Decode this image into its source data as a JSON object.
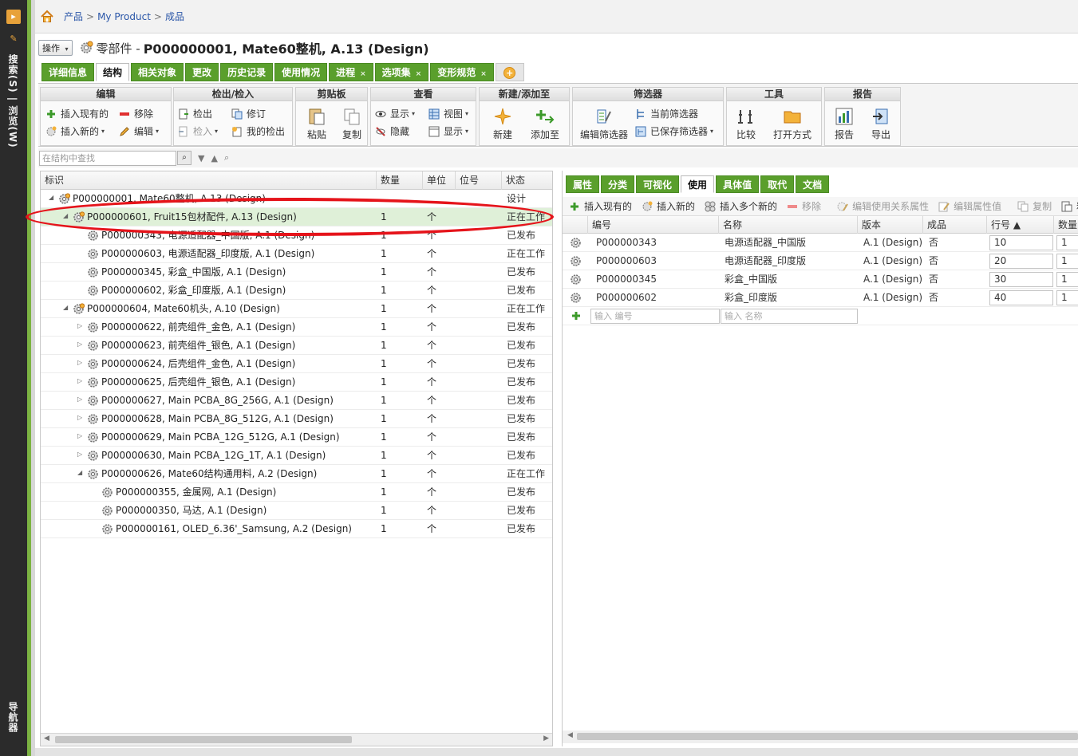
{
  "sidebar": {
    "search_browse": "搜索(S) | 浏览(W)",
    "bottom_label": "导航器"
  },
  "breadcrumb": {
    "items": [
      "产品",
      "My Product",
      "成品"
    ],
    "separator": ">"
  },
  "title": {
    "ops_label": "操作",
    "prefix": "零部件 -",
    "main": "P000000001, Mate60整机, A.13 (Design)"
  },
  "main_tabs": [
    {
      "label": "详细信息",
      "active": false,
      "closable": false
    },
    {
      "label": "结构",
      "active": true,
      "closable": false
    },
    {
      "label": "相关对象",
      "active": false,
      "closable": false
    },
    {
      "label": "更改",
      "active": false,
      "closable": false
    },
    {
      "label": "历史记录",
      "active": false,
      "closable": false
    },
    {
      "label": "使用情况",
      "active": false,
      "closable": false
    },
    {
      "label": "进程",
      "active": false,
      "closable": true
    },
    {
      "label": "选项集",
      "active": false,
      "closable": true
    },
    {
      "label": "变形规范",
      "active": false,
      "closable": true
    }
  ],
  "ribbon": {
    "edit": {
      "title": "编辑",
      "insert_existing": "插入现有的",
      "remove": "移除",
      "insert_new": "插入新的",
      "edit": "编辑"
    },
    "checkout": {
      "title": "检出/检入",
      "checkout": "检出",
      "revise": "修订",
      "checkin": "检入",
      "my_checkouts": "我的检出"
    },
    "clipboard": {
      "title": "剪贴板",
      "paste": "粘贴",
      "copy": "复制"
    },
    "view": {
      "title": "查看",
      "show": "显示",
      "view": "视图",
      "hide": "隐藏",
      "display": "显示"
    },
    "create": {
      "title": "新建/添加至",
      "new": "新建",
      "add_to": "添加至"
    },
    "filter": {
      "title": "筛选器",
      "edit_filter": "编辑筛选器",
      "current_filter": "当前筛选器",
      "saved_filter": "已保存筛选器"
    },
    "tools": {
      "title": "工具",
      "compare": "比较",
      "open_with": "打开方式"
    },
    "report": {
      "title": "报告",
      "report": "报告",
      "export": "导出"
    }
  },
  "search": {
    "placeholder": "在结构中查找"
  },
  "tree": {
    "columns": [
      "标识",
      "数量",
      "单位",
      "位号",
      "状态"
    ],
    "rows": [
      {
        "label": "P000000001, Mate60整机, A.13 (Design)",
        "qty": "",
        "unit": "",
        "state": "设计",
        "level": 0,
        "toggle": "open"
      },
      {
        "label": "P000000601, Fruit15包材配件, A.13 (Design)",
        "qty": "1",
        "unit": "个",
        "state": "正在工作",
        "level": 1,
        "toggle": "open",
        "selected": true
      },
      {
        "label": "P000000343, 电源适配器_中国版, A.1 (Design)",
        "qty": "1",
        "unit": "个",
        "state": "已发布",
        "level": 2,
        "toggle": "none"
      },
      {
        "label": "P000000603, 电源适配器_印度版, A.1 (Design)",
        "qty": "1",
        "unit": "个",
        "state": "正在工作",
        "level": 2,
        "toggle": "none"
      },
      {
        "label": "P000000345, 彩盒_中国版, A.1 (Design)",
        "qty": "1",
        "unit": "个",
        "state": "已发布",
        "level": 2,
        "toggle": "none"
      },
      {
        "label": "P000000602, 彩盒_印度版, A.1 (Design)",
        "qty": "1",
        "unit": "个",
        "state": "已发布",
        "level": 2,
        "toggle": "none"
      },
      {
        "label": "P000000604, Mate60机头, A.10 (Design)",
        "qty": "1",
        "unit": "个",
        "state": "正在工作",
        "level": 1,
        "toggle": "open"
      },
      {
        "label": "P000000622, 前壳组件_金色, A.1 (Design)",
        "qty": "1",
        "unit": "个",
        "state": "已发布",
        "level": 2,
        "toggle": "closed"
      },
      {
        "label": "P000000623, 前壳组件_银色, A.1 (Design)",
        "qty": "1",
        "unit": "个",
        "state": "已发布",
        "level": 2,
        "toggle": "closed"
      },
      {
        "label": "P000000624, 后壳组件_金色, A.1 (Design)",
        "qty": "1",
        "unit": "个",
        "state": "已发布",
        "level": 2,
        "toggle": "closed"
      },
      {
        "label": "P000000625, 后壳组件_银色, A.1 (Design)",
        "qty": "1",
        "unit": "个",
        "state": "已发布",
        "level": 2,
        "toggle": "closed"
      },
      {
        "label": "P000000627, Main PCBA_8G_256G, A.1 (Design)",
        "qty": "1",
        "unit": "个",
        "state": "已发布",
        "level": 2,
        "toggle": "closed"
      },
      {
        "label": "P000000628, Main PCBA_8G_512G, A.1 (Design)",
        "qty": "1",
        "unit": "个",
        "state": "已发布",
        "level": 2,
        "toggle": "closed"
      },
      {
        "label": "P000000629, Main PCBA_12G_512G, A.1 (Design)",
        "qty": "1",
        "unit": "个",
        "state": "已发布",
        "level": 2,
        "toggle": "closed"
      },
      {
        "label": "P000000630, Main PCBA_12G_1T, A.1 (Design)",
        "qty": "1",
        "unit": "个",
        "state": "已发布",
        "level": 2,
        "toggle": "closed"
      },
      {
        "label": "P000000626, Mate60结构通用料, A.2 (Design)",
        "qty": "1",
        "unit": "个",
        "state": "正在工作",
        "level": 2,
        "toggle": "open"
      },
      {
        "label": "P000000355, 金属网, A.1 (Design)",
        "qty": "1",
        "unit": "个",
        "state": "已发布",
        "level": 3,
        "toggle": "none"
      },
      {
        "label": "P000000350, 马达, A.1 (Design)",
        "qty": "1",
        "unit": "个",
        "state": "已发布",
        "level": 3,
        "toggle": "none"
      },
      {
        "label": "P000000161, OLED_6.36'_Samsung, A.2 (Design)",
        "qty": "1",
        "unit": "个",
        "state": "已发布",
        "level": 3,
        "toggle": "none"
      }
    ]
  },
  "right": {
    "tabs": [
      {
        "label": "属性",
        "active": false
      },
      {
        "label": "分类",
        "active": false
      },
      {
        "label": "可视化",
        "active": false
      },
      {
        "label": "使用",
        "active": true
      },
      {
        "label": "具体值",
        "active": false
      },
      {
        "label": "取代",
        "active": false
      },
      {
        "label": "文档",
        "active": false
      }
    ],
    "toolbar": {
      "insert_existing": "插入现有的",
      "insert_new": "插入新的",
      "insert_multiple": "插入多个新的",
      "remove": "移除",
      "edit_usage_attrs": "编辑使用关系属性",
      "edit_attr_values": "编辑属性值",
      "copy": "复制",
      "paste": "粘"
    },
    "columns": [
      "编号",
      "名称",
      "版本",
      "成品",
      "行号 ▲",
      "数量"
    ],
    "rows": [
      {
        "number": "P000000343",
        "name": "电源适配器_中国版",
        "version": "A.1 (Design)",
        "finished": "否",
        "line": "10",
        "qty": "1"
      },
      {
        "number": "P000000603",
        "name": "电源适配器_印度版",
        "version": "A.1 (Design)",
        "finished": "否",
        "line": "20",
        "qty": "1"
      },
      {
        "number": "P000000345",
        "name": "彩盒_中国版",
        "version": "A.1 (Design)",
        "finished": "否",
        "line": "30",
        "qty": "1"
      },
      {
        "number": "P000000602",
        "name": "彩盒_印度版",
        "version": "A.1 (Design)",
        "finished": "否",
        "line": "40",
        "qty": "1"
      }
    ],
    "new_row": {
      "number_placeholder": "输入 编号",
      "name_placeholder": "输入 名称"
    }
  },
  "colors": {
    "tab_green": "#5a9f2c",
    "selection_green": "#dff0d8",
    "annotation_red": "#e5141b",
    "link_blue": "#2a56a8"
  }
}
